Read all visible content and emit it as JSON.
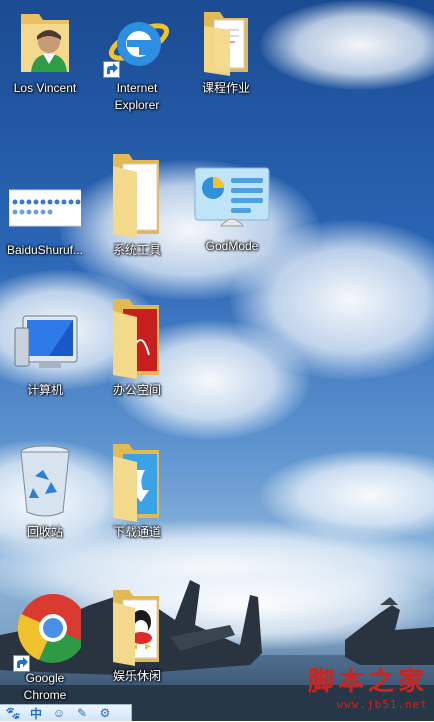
{
  "desktop_icons": [
    {
      "label": "Los Vincent",
      "icon": "user-folder-icon"
    },
    {
      "label": "Internet\nExplorer",
      "icon": "internet-explorer-icon"
    },
    {
      "label": "课程作业",
      "icon": "folder-icon"
    },
    {
      "label": "BaiduShuruf...",
      "icon": "baidu-input-icon"
    },
    {
      "label": "系统工具",
      "icon": "folder-icon"
    },
    {
      "label": "GodMode",
      "icon": "control-panel-icon"
    },
    {
      "label": "计算机",
      "icon": "computer-icon"
    },
    {
      "label": "办公空间",
      "icon": "folder-icon"
    },
    {
      "label": "回收站",
      "icon": "recycle-bin-icon"
    },
    {
      "label": "下载通道",
      "icon": "folder-icon"
    },
    {
      "label": "Google\nChrome",
      "icon": "chrome-icon"
    },
    {
      "label": "娱乐休闲",
      "icon": "folder-icon"
    }
  ],
  "taskbar": {
    "items": [
      {
        "icon": "paw-icon",
        "glyph": "🐾"
      },
      {
        "icon": "chinese-mode-icon",
        "glyph": "中"
      },
      {
        "icon": "emoji-icon",
        "glyph": "☺"
      },
      {
        "icon": "pen-icon",
        "glyph": "✎"
      },
      {
        "icon": "settings-icon",
        "glyph": "⚙"
      }
    ]
  },
  "watermark": {
    "text": "脚本之家",
    "url": "www.jb51.net"
  },
  "colors": {
    "sky_top": "#1b4b92",
    "folder": "#f3d98b",
    "watermark": "#d2221c"
  }
}
